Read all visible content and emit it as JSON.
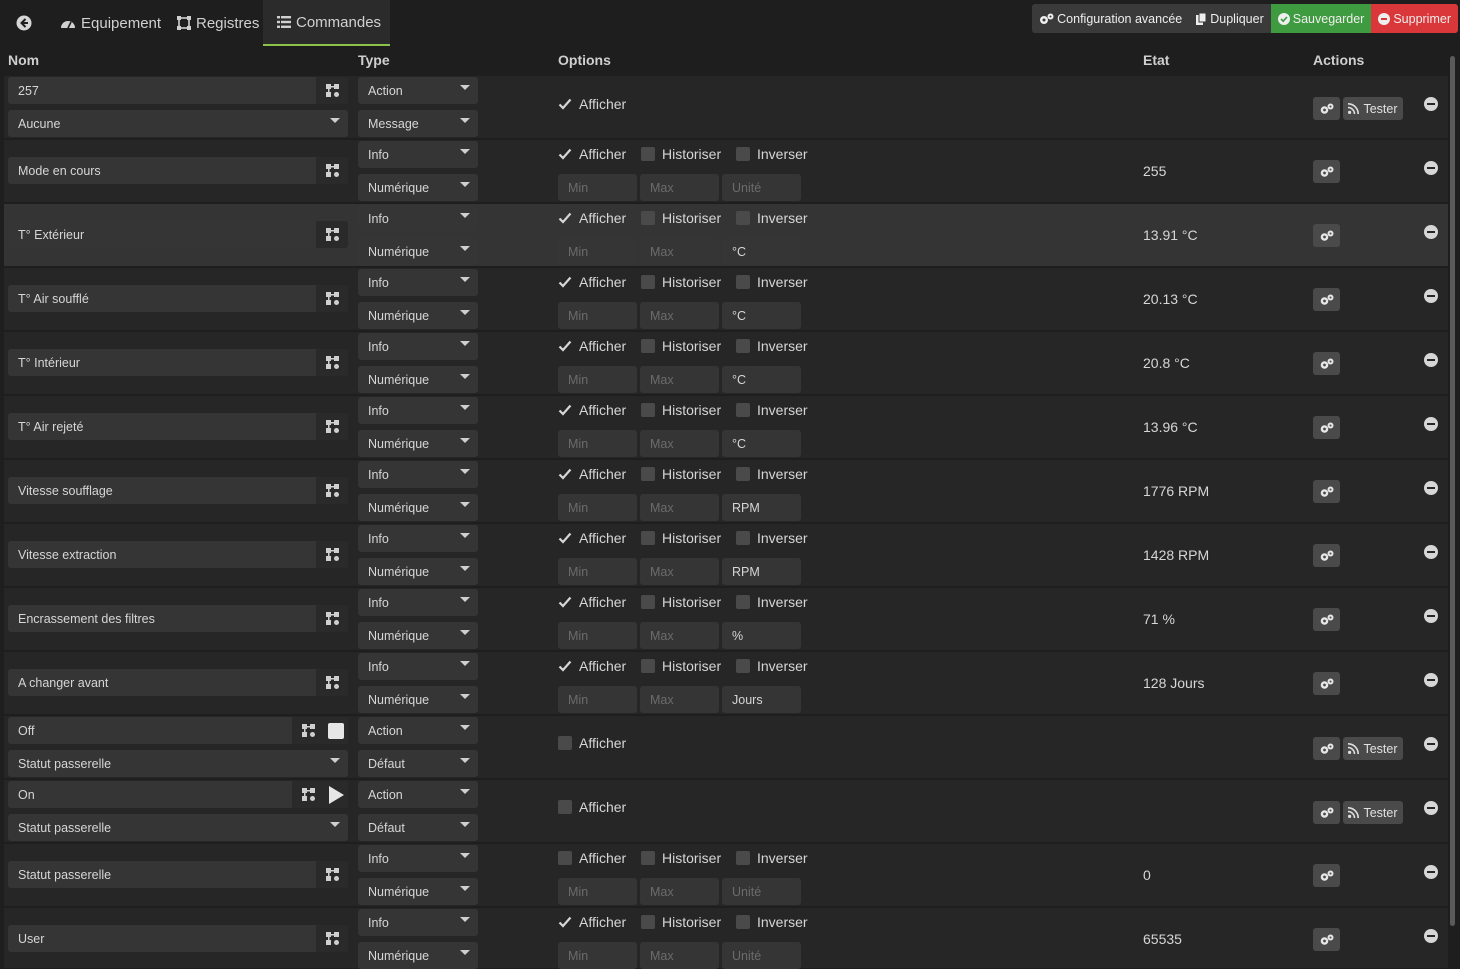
{
  "tabs": {
    "back_icon": "arrow-left-icon",
    "equipement": "Equipement",
    "registres": "Registres",
    "commandes": "Commandes"
  },
  "buttons": {
    "config": "Configuration avancée",
    "dupliquer": "Dupliquer",
    "sauvegarder": "Sauvegarder",
    "supprimer": "Supprimer",
    "save_color": "#3f9b3f",
    "delete_color": "#d9373a"
  },
  "headers": {
    "nom": "Nom",
    "type": "Type",
    "options": "Options",
    "etat": "Etat",
    "actions": "Actions"
  },
  "labels": {
    "afficher": "Afficher",
    "historiser": "Historiser",
    "inverser": "Inverser",
    "tester": "Tester",
    "min": "Min",
    "max": "Max",
    "unite": "Unité"
  },
  "rows": [
    {
      "name": "257",
      "name2": "Aucune",
      "type": "Action",
      "subtype": "Message",
      "afficher": true,
      "etat": ""
    },
    {
      "name": "Mode en cours",
      "type": "Info",
      "subtype": "Numérique",
      "afficher": true,
      "historiser": false,
      "inverser": false,
      "unit": "",
      "etat": "255"
    },
    {
      "name": "T° Extérieur",
      "type": "Info",
      "subtype": "Numérique",
      "afficher": true,
      "historiser": false,
      "inverser": false,
      "unit": "°C",
      "etat": "13.91 °C"
    },
    {
      "name": "T° Air soufflé",
      "type": "Info",
      "subtype": "Numérique",
      "afficher": true,
      "historiser": false,
      "inverser": false,
      "unit": "°C",
      "etat": "20.13 °C"
    },
    {
      "name": "T° Intérieur",
      "type": "Info",
      "subtype": "Numérique",
      "afficher": true,
      "historiser": false,
      "inverser": false,
      "unit": "°C",
      "etat": "20.8 °C"
    },
    {
      "name": "T° Air rejeté",
      "type": "Info",
      "subtype": "Numérique",
      "afficher": true,
      "historiser": false,
      "inverser": false,
      "unit": "°C",
      "etat": "13.96 °C"
    },
    {
      "name": "Vitesse soufflage",
      "type": "Info",
      "subtype": "Numérique",
      "afficher": true,
      "historiser": false,
      "inverser": false,
      "unit": "RPM",
      "etat": "1776 RPM"
    },
    {
      "name": "Vitesse extraction",
      "type": "Info",
      "subtype": "Numérique",
      "afficher": true,
      "historiser": false,
      "inverser": false,
      "unit": "RPM",
      "etat": "1428 RPM"
    },
    {
      "name": "Encrassement des filtres",
      "type": "Info",
      "subtype": "Numérique",
      "afficher": true,
      "historiser": false,
      "inverser": false,
      "unit": "%",
      "etat": "71 %"
    },
    {
      "name": "A changer avant",
      "type": "Info",
      "subtype": "Numérique",
      "afficher": true,
      "historiser": false,
      "inverser": false,
      "unit": "Jours",
      "etat": "128 Jours"
    },
    {
      "name": "Off",
      "name2": "Statut passerelle",
      "type": "Action",
      "subtype": "Défaut",
      "afficher": false,
      "etat": ""
    },
    {
      "name": "On",
      "name2": "Statut passerelle",
      "type": "Action",
      "subtype": "Défaut",
      "afficher": false,
      "etat": ""
    },
    {
      "name": "Statut passerelle",
      "type": "Info",
      "subtype": "Numérique",
      "afficher": false,
      "historiser": false,
      "inverser": false,
      "unit": "",
      "etat": "0"
    },
    {
      "name": "User",
      "type": "Info",
      "subtype": "Numérique",
      "afficher": true,
      "historiser": false,
      "inverser": false,
      "unit": "",
      "etat": "65535"
    }
  ]
}
